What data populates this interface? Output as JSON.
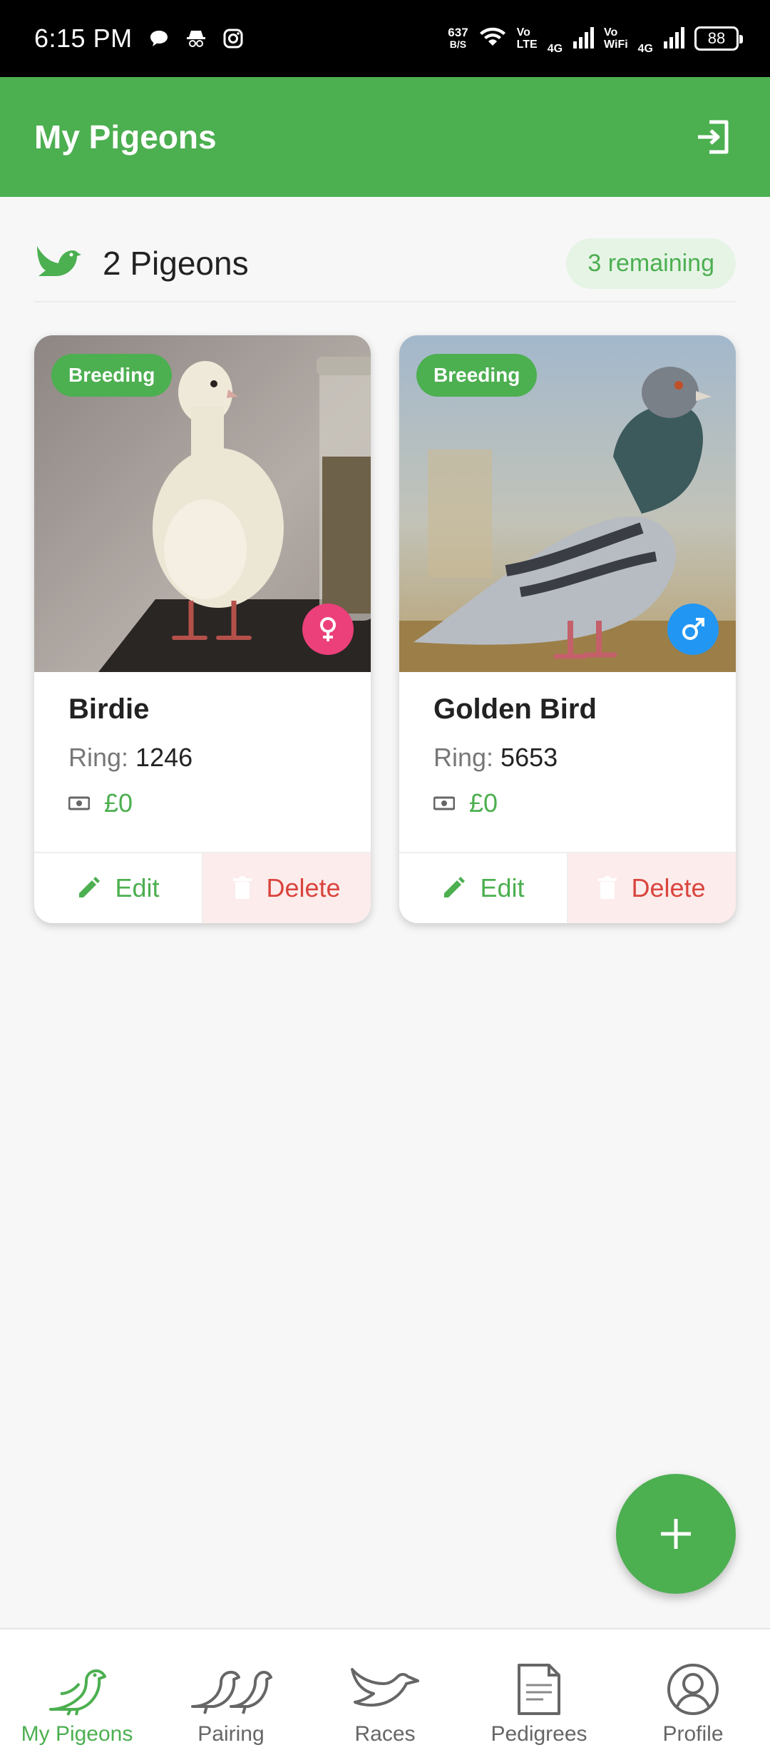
{
  "status_bar": {
    "time": "6:15 PM",
    "speed_value": "637",
    "speed_unit": "B/S",
    "volte_top": "Vo",
    "volte_bottom": "LTE",
    "net1": "4G",
    "vowifi_top": "Vo",
    "vowifi_bottom": "WiFi",
    "net2": "4G",
    "battery": "88",
    "icons": [
      "chat-icon",
      "incognito-icon",
      "instagram-icon",
      "wifi-icon",
      "signal-icon",
      "battery-icon"
    ]
  },
  "app_bar": {
    "title": "My Pigeons",
    "action_icon": "login-icon"
  },
  "summary": {
    "count_label": "2 Pigeons",
    "remaining_label": "3 remaining",
    "icon": "bird-icon"
  },
  "pigeons": [
    {
      "status": "Breeding",
      "name": "Birdie",
      "ring_label": "Ring:",
      "ring": "1246",
      "price": "£0",
      "gender": "female",
      "gender_symbol": "♀",
      "gender_color": "#ec407a",
      "edit_label": "Edit",
      "delete_label": "Delete"
    },
    {
      "status": "Breeding",
      "name": "Golden Bird",
      "ring_label": "Ring:",
      "ring": "5653",
      "price": "£0",
      "gender": "male",
      "gender_symbol": "♂",
      "gender_color": "#2196f3",
      "edit_label": "Edit",
      "delete_label": "Delete"
    }
  ],
  "fab": {
    "icon": "plus-icon"
  },
  "bottom_nav": [
    {
      "label": "My Pigeons",
      "icon": "bird-icon",
      "active": true
    },
    {
      "label": "Pairing",
      "icon": "pair-birds-icon",
      "active": false
    },
    {
      "label": "Races",
      "icon": "dove-icon",
      "active": false
    },
    {
      "label": "Pedigrees",
      "icon": "document-icon",
      "active": false
    },
    {
      "label": "Profile",
      "icon": "profile-icon",
      "active": false
    }
  ],
  "colors": {
    "primary": "#4caf50",
    "danger": "#d9453d",
    "danger_bg": "#fdecec",
    "female": "#ec407a",
    "male": "#2196f3"
  }
}
